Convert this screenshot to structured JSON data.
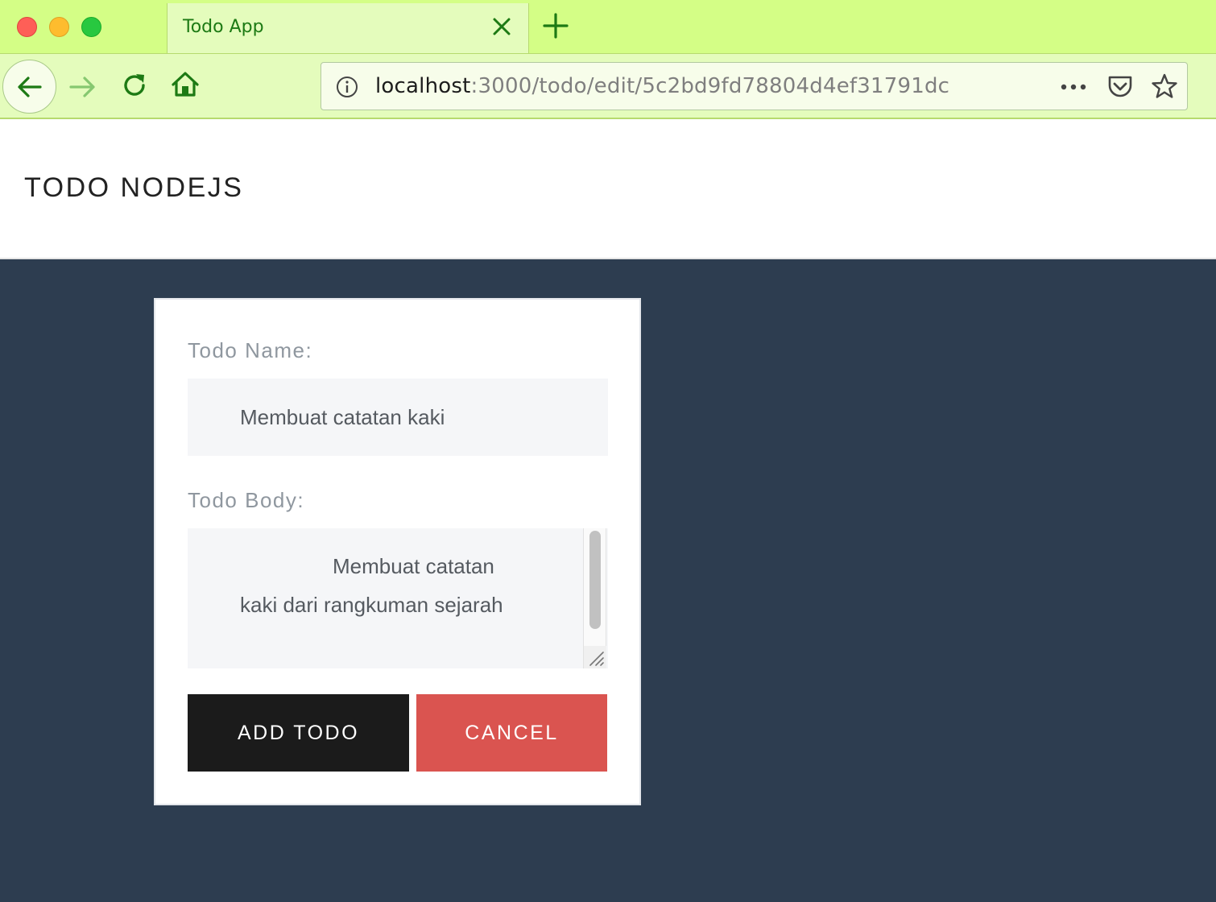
{
  "browser": {
    "tab": {
      "title": "Todo App"
    },
    "url": {
      "host": "localhost",
      "rest": ":3000/todo/edit/5c2bd9fd78804d4ef31791dc"
    },
    "icons": {
      "back": "back-arrow-icon",
      "forward": "forward-arrow-icon",
      "reload": "reload-icon",
      "home": "home-icon",
      "info": "info-icon",
      "more": "more-icon",
      "pocket": "pocket-icon",
      "bookmark": "star-icon"
    },
    "colors": {
      "chrome": "#d4fe86",
      "tab_active": "#e4fcbc",
      "icon": "#1d7a14"
    }
  },
  "header": {
    "brand": "TODO NODEJS"
  },
  "form": {
    "name_label": "Todo Name:",
    "name_value": "Membuat catatan kaki",
    "body_label": "Todo Body:",
    "body_lines": [
      "Membuat catatan",
      "kaki dari rangkuman sejarah"
    ],
    "submit_label": "ADD TODO",
    "cancel_label": "CANCEL"
  },
  "colors": {
    "page_background": "#2d3d50",
    "submit_button": "#1b1b1b",
    "cancel_button": "#da5450"
  }
}
